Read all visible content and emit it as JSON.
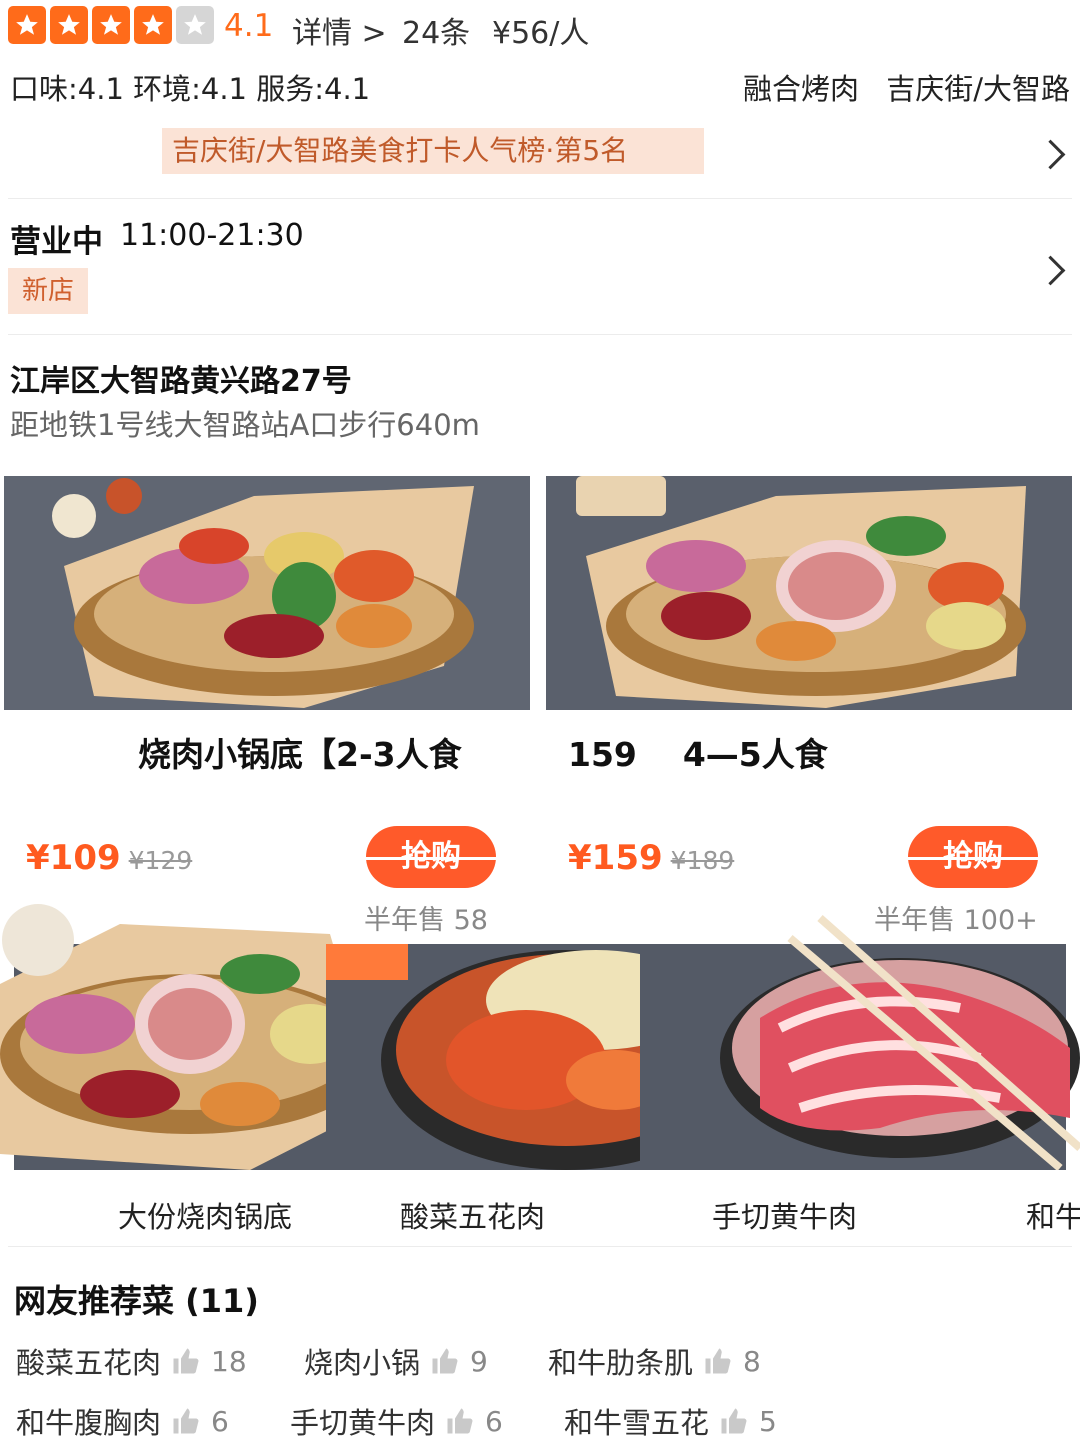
{
  "header": {
    "rating": 4.1,
    "stars_filled": 4,
    "stars_total": 5,
    "rating_text": "4.1",
    "detail_link": "详情 >",
    "review_count": "24条",
    "avg_price": "¥56/人"
  },
  "scores": {
    "text": "口味:4.1  环境:4.1  服务:4.1",
    "category": "融合烤肉",
    "location": "吉庆街/大智路"
  },
  "rank_banner": {
    "text": "吉庆街/大智路美食打卡人气榜·第5名"
  },
  "hours": {
    "status": "营业中",
    "time": "11:00-21:30",
    "badge": "新店"
  },
  "address": {
    "street": "江岸区大智路黄兴路27号",
    "transit": "距地铁1号线大智路站A口步行640m"
  },
  "deals": [
    {
      "title": "烧肉小锅底【2-3人食",
      "price": "¥109",
      "original_price": "¥129",
      "button": "抢购",
      "sold": "半年售 58"
    },
    {
      "title": "159    4—5人食",
      "price": "¥159",
      "original_price": "¥189",
      "button": "抢购",
      "sold": "半年售 100+"
    }
  ],
  "dishes": [
    {
      "name": "大份烧肉锅底"
    },
    {
      "name": "酸菜五花肉"
    },
    {
      "name": "手切黄牛肉"
    },
    {
      "name": "和牛"
    }
  ],
  "recommendations": {
    "title": "网友推荐菜 (11)",
    "items": [
      {
        "name": "酸菜五花肉",
        "count": "18"
      },
      {
        "name": "烧肉小锅",
        "count": "9"
      },
      {
        "name": "和牛肋条肌",
        "count": "8"
      },
      {
        "name": "和牛腹胸肉",
        "count": "6"
      },
      {
        "name": "手切黄牛肉",
        "count": "6"
      },
      {
        "name": "和牛雪五花",
        "count": "5"
      }
    ]
  },
  "colors": {
    "accent": "#ff5a1f",
    "star": "#ff6b1a",
    "banner_bg": "#fbe3d6"
  },
  "icons": [
    "star-icon",
    "chevron-right-icon",
    "thumb-up-icon"
  ]
}
